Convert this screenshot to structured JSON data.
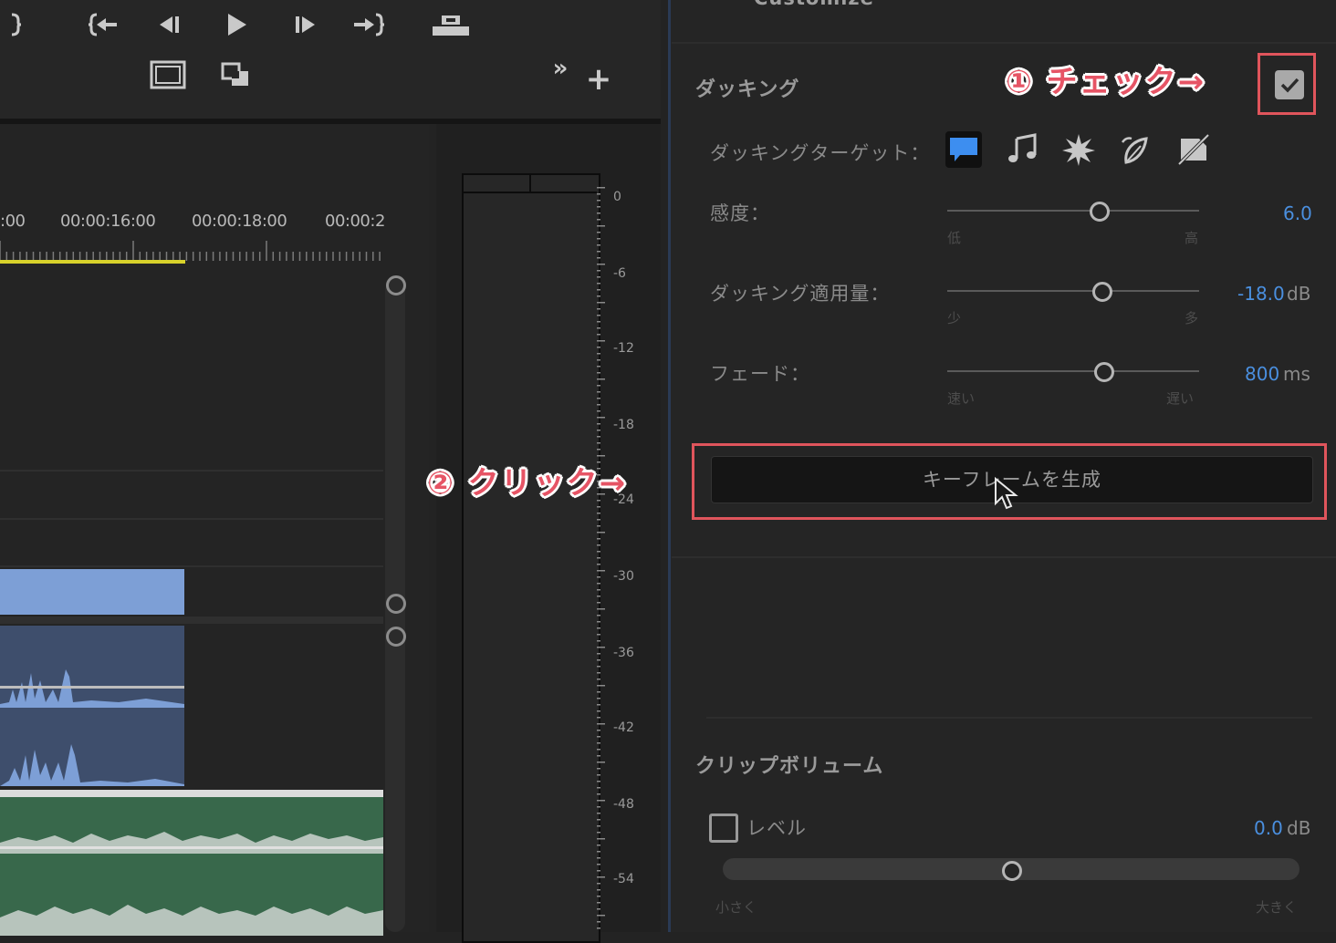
{
  "monitor": {
    "buttons": [
      {
        "name": "mark-out-button",
        "icon": "mark-out-icon"
      },
      {
        "name": "go-to-in-button",
        "icon": "go-to-in-icon"
      },
      {
        "name": "step-back-button",
        "icon": "step-back-icon"
      },
      {
        "name": "play-button",
        "icon": "play-icon"
      },
      {
        "name": "step-forward-button",
        "icon": "step-forward-icon"
      },
      {
        "name": "go-to-out-button",
        "icon": "go-to-out-icon"
      },
      {
        "name": "lift-button",
        "icon": "lift-icon"
      },
      {
        "name": "safe-margins-button",
        "icon": "safe-margins-icon"
      },
      {
        "name": "comparison-view-button",
        "icon": "comparison-view-icon"
      },
      {
        "name": "more-button",
        "icon": "double-chevron-icon",
        "label": "»"
      },
      {
        "name": "add-button",
        "icon": "plus-icon",
        "label": "+"
      }
    ]
  },
  "timeline": {
    "timecodes": [
      ":00",
      "00:00:16:00",
      "00:00:18:00",
      "00:00:2"
    ],
    "clip_colors": {
      "video": "#7d9fd6",
      "audio": "#3e4e6c",
      "music": "#38684b"
    }
  },
  "meter": {
    "labels": [
      "0",
      "-6",
      "-12",
      "-18",
      "-24",
      "-30",
      "-36",
      "-42",
      "-48",
      "-54"
    ]
  },
  "panel": {
    "top_label": "Customize",
    "ducking": {
      "title": "ダッキング",
      "checked": true,
      "target_label": "ダッキングターゲット：",
      "targets": [
        {
          "name": "dialogue-target-icon",
          "active": true
        },
        {
          "name": "music-target-icon",
          "active": false
        },
        {
          "name": "sfx-target-icon",
          "active": false
        },
        {
          "name": "ambience-target-icon",
          "active": false
        },
        {
          "name": "unassigned-target-icon",
          "active": false
        }
      ],
      "sensitivity": {
        "label": "感度：",
        "min": "低",
        "max": "高",
        "value": "6.0",
        "unit": "",
        "position": 0.6
      },
      "amount": {
        "label": "ダッキング適用量：",
        "min": "少",
        "max": "多",
        "value": "-18.0",
        "unit": "dB",
        "position": 0.61
      },
      "fade": {
        "label": "フェード：",
        "min": "速い",
        "max": "遅い",
        "value": "800",
        "unit": "ms",
        "position": 0.62
      },
      "generate_button": "キーフレームを生成"
    },
    "clip_volume": {
      "title": "クリップボリューム",
      "level_label": "レベル",
      "level_checked": false,
      "value": "0.0",
      "unit": "dB",
      "min": "小さく",
      "max": "大きく",
      "position": 0.5
    }
  },
  "annotations": {
    "step1": "① チェック→",
    "step2": "② クリック→"
  },
  "colors": {
    "accent_blue": "#4a8fdf",
    "highlight_red": "#e0555c",
    "annotation_red": "#e65465"
  }
}
